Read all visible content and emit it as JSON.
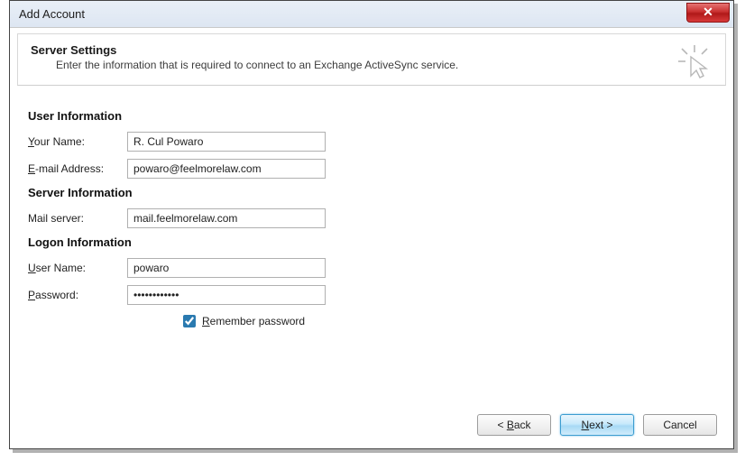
{
  "window": {
    "title": "Add Account"
  },
  "header": {
    "title": "Server Settings",
    "subtitle": "Enter the information that is required to connect to an Exchange ActiveSync service."
  },
  "sections": {
    "user_info": "User Information",
    "server_info": "Server Information",
    "logon_info": "Logon Information"
  },
  "labels": {
    "your_name_pre": "Y",
    "your_name_rest": "our Name:",
    "email_pre": "E",
    "email_rest": "-mail Address:",
    "mail_server": "Mail server:",
    "user_name_pre": "U",
    "user_name_rest": "ser Name:",
    "password_pre": "P",
    "password_rest": "assword:",
    "remember_pre": "R",
    "remember_rest": "emember password"
  },
  "values": {
    "your_name": "R. Cul Powaro",
    "email": "powaro@feelmorelaw.com",
    "mail_server": "mail.feelmorelaw.com",
    "user_name": "powaro",
    "password": "************",
    "remember_checked": true
  },
  "buttons": {
    "back_pre": "< ",
    "back_u": "B",
    "back_rest": "ack",
    "next_u": "N",
    "next_rest": "ext >",
    "cancel": "Cancel"
  }
}
